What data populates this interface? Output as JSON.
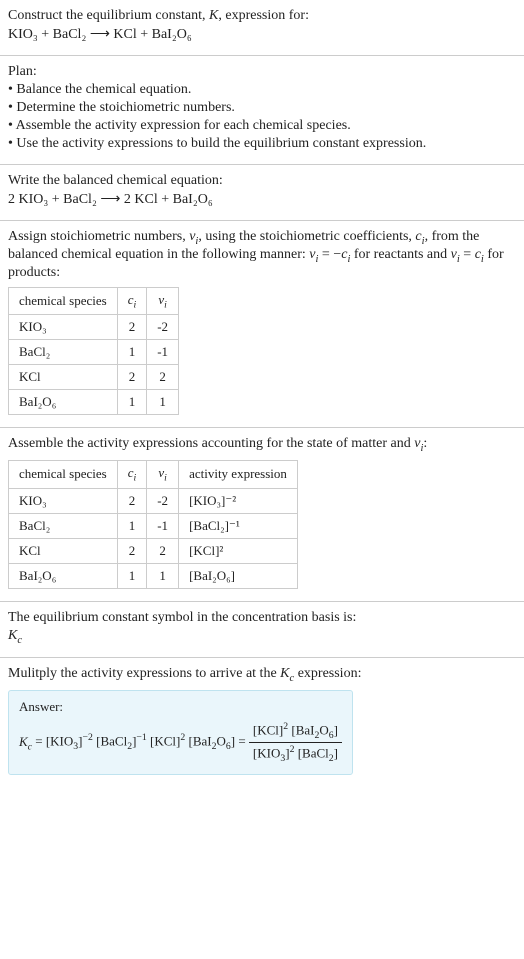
{
  "s1": {
    "line1": "Construct the equilibrium constant, K, expression for:",
    "line2": "KIO₃ + BaCl₂ ⟶ KCl + BaI₂O₆"
  },
  "s2": {
    "title": "Plan:",
    "b1": "• Balance the chemical equation.",
    "b2": "• Determine the stoichiometric numbers.",
    "b3": "• Assemble the activity expression for each chemical species.",
    "b4": "• Use the activity expressions to build the equilibrium constant expression."
  },
  "s3": {
    "line1": "Write the balanced chemical equation:",
    "line2": "2 KIO₃ + BaCl₂ ⟶ 2 KCl + BaI₂O₆"
  },
  "s4": {
    "p1": "Assign stoichiometric numbers, νᵢ, using the stoichiometric coefficients, cᵢ, from the balanced chemical equation in the following manner: νᵢ = −cᵢ for reactants and νᵢ = cᵢ for products:",
    "h1": "chemical species",
    "h2": "cᵢ",
    "h3": "νᵢ",
    "r1c1": "KIO₃",
    "r1c2": "2",
    "r1c3": "-2",
    "r2c1": "BaCl₂",
    "r2c2": "1",
    "r2c3": "-1",
    "r3c1": "KCl",
    "r3c2": "2",
    "r3c3": "2",
    "r4c1": "BaI₂O₆",
    "r4c2": "1",
    "r4c3": "1"
  },
  "s5": {
    "p1": "Assemble the activity expressions accounting for the state of matter and νᵢ:",
    "h1": "chemical species",
    "h2": "cᵢ",
    "h3": "νᵢ",
    "h4": "activity expression",
    "r1c1": "KIO₃",
    "r1c2": "2",
    "r1c3": "-2",
    "r1c4": "[KIO₃]⁻²",
    "r2c1": "BaCl₂",
    "r2c2": "1",
    "r2c3": "-1",
    "r2c4": "[BaCl₂]⁻¹",
    "r3c1": "KCl",
    "r3c2": "2",
    "r3c3": "2",
    "r3c4": "[KCl]²",
    "r4c1": "BaI₂O₆",
    "r4c2": "1",
    "r4c3": "1",
    "r4c4": "[BaI₂O₆]"
  },
  "s6": {
    "line1": "The equilibrium constant symbol in the concentration basis is:",
    "line2": "K_c"
  },
  "s7": {
    "p1": "Mulitply the activity expressions to arrive at the K_c expression:",
    "answer_label": "Answer:",
    "lhs": "K_c = [KIO₃]⁻² [BaCl₂]⁻¹ [KCl]² [BaI₂O₆] = ",
    "num": "[KCl]² [BaI₂O₆]",
    "den": "[KIO₃]² [BaCl₂]"
  }
}
